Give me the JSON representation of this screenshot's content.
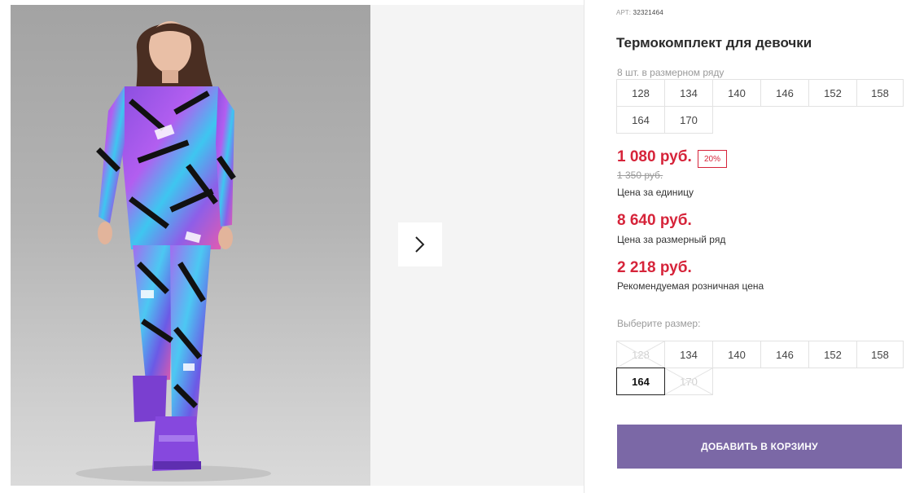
{
  "product": {
    "art_label": "АРТ:",
    "art_value": "32321464",
    "title": "Термокомплект для девочки"
  },
  "size_range": {
    "caption": "8 шт. в размерном ряду",
    "sizes": [
      "128",
      "134",
      "140",
      "146",
      "152",
      "158",
      "164",
      "170"
    ]
  },
  "prices": {
    "unit_price": "1 080 руб.",
    "discount": "20%",
    "old_price": "1 350 руб.",
    "unit_caption": "Цена за единицу",
    "range_price": "8 640 руб.",
    "range_caption": "Цена за размерный ряд",
    "retail_price": "2 218 руб.",
    "retail_caption": "Рекомендуемая розничная цена",
    "accent_color": "#d6243a"
  },
  "size_picker": {
    "label": "Выберите размер:",
    "sizes": [
      {
        "label": "128",
        "state": "disabled"
      },
      {
        "label": "134",
        "state": "available"
      },
      {
        "label": "140",
        "state": "available"
      },
      {
        "label": "146",
        "state": "available"
      },
      {
        "label": "152",
        "state": "available"
      },
      {
        "label": "158",
        "state": "available"
      },
      {
        "label": "164",
        "state": "selected"
      },
      {
        "label": "170",
        "state": "disabled"
      }
    ]
  },
  "cart": {
    "add_label": "ДОБАВИТЬ В КОРЗИНУ",
    "button_color": "#7b68a6"
  },
  "gallery": {
    "next_icon": "chevron-right-icon"
  }
}
